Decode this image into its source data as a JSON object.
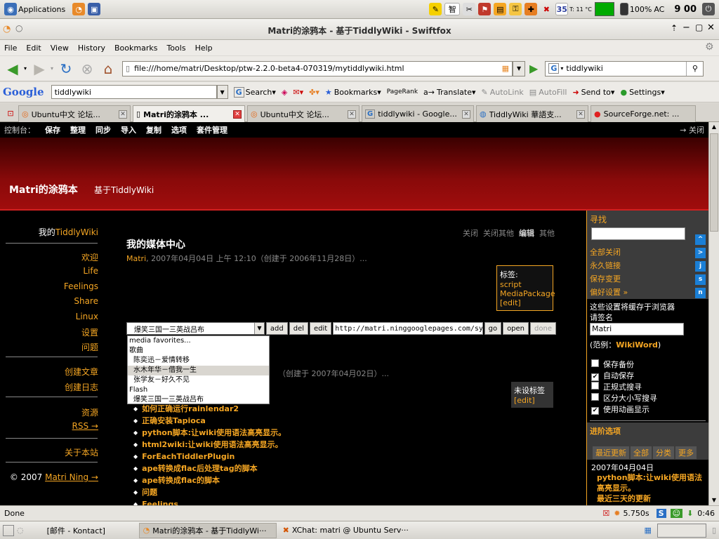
{
  "top_panel": {
    "applications": "Applications",
    "ime_label": "智",
    "temp": "35",
    "temp_sub": "T: 11 °C",
    "battery": "100%",
    "ac": "AC",
    "clock": "9 00"
  },
  "window": {
    "title": "Matri的涂鸦本 - 基于TiddlyWiki - Swiftfox"
  },
  "menubar": [
    "File",
    "Edit",
    "View",
    "History",
    "Bookmarks",
    "Tools",
    "Help"
  ],
  "navbar": {
    "url": "file:///home/matri/Desktop/ptw-2.2.0-beta4-070319/mytiddlywiki.html",
    "search_value": "tiddlywiki"
  },
  "google_bar": {
    "logo": "Google",
    "query": "tiddlywiki",
    "search": "Search",
    "bookmarks": "Bookmarks",
    "pagerank": "PageRank",
    "translate": "Translate",
    "autolink": "AutoLink",
    "autofill": "AutoFill",
    "send_to": "Send to",
    "settings": "Settings"
  },
  "tabs": [
    {
      "label": "Ubuntu中文 论坛...",
      "active": false
    },
    {
      "label": "Matri的涂鸦本 ...",
      "active": true
    },
    {
      "label": "Ubuntu中文 论坛...",
      "active": false
    },
    {
      "label": "tiddlywiki - Google...",
      "active": false
    },
    {
      "label": "TiddlyWiki 華語支...",
      "active": false
    },
    {
      "label": "SourceForge.net: ...",
      "active": false
    }
  ],
  "backstage": {
    "label": "控制台：",
    "items": [
      "保存",
      "整理",
      "同步",
      "导入",
      "复制",
      "选项",
      "套件管理"
    ],
    "close": "→ 关闭"
  },
  "site": {
    "title": "Matri的涂鸦本",
    "subtitle": "基于TiddlyWiki"
  },
  "main_menu": {
    "my_prefix": "我的",
    "my_link": "TiddlyWiki",
    "group1": [
      "欢迎",
      "Life",
      "Feelings",
      "Share",
      "Linux",
      "设置",
      "问题"
    ],
    "group2": [
      "创建文章",
      "创建日志"
    ],
    "group3": [
      "资源",
      "RSS →"
    ],
    "about": "关于本站",
    "copyright": "© 2007",
    "author": "Matri Ning →"
  },
  "tiddler": {
    "toolbar": [
      "关闭",
      "关闭其他",
      "编辑",
      "其他"
    ],
    "title": "我的媒体中心",
    "author": "Matri",
    "date": ", 2007年04月04日 上午 12:10（创建于 2006年11月28日）...",
    "tags_label": "标签:",
    "tags": [
      "script",
      "MediaPackage"
    ],
    "tags_edit": "[edit]"
  },
  "media_player": {
    "selected": "爆笑三国一三英战吕布",
    "buttons": [
      "add",
      "del",
      "edit"
    ],
    "url": "http://matri.ninggooglepages.com/sy2lb.swf",
    "go": "go",
    "open": "open",
    "done": "done",
    "options": [
      {
        "text": "media favorites...",
        "indent": false
      },
      {
        "text": "歌曲",
        "indent": false
      },
      {
        "text": "陈奕迅－爱情转移",
        "indent": true
      },
      {
        "text": "水木年华－借我一生",
        "indent": true,
        "selected": true
      },
      {
        "text": "张学友－好久不见",
        "indent": true
      },
      {
        "text": "Flash",
        "indent": false
      },
      {
        "text": "爆笑三国一三英战吕布",
        "indent": true
      }
    ]
  },
  "tiddler2": {
    "sub": "（创建于 2007年04月02日）...",
    "tags_label": "未设标签",
    "tags_edit": "[edit]",
    "list": [
      "如何正确运行rainlendar2",
      "正确安装Tapioca",
      "python脚本:让wiki使用语法高亮显示。",
      "html2wiki:让wiki使用语法高亮显示。",
      "ForEachTiddlerPlugin",
      "ape转换成flac后处理tag的脚本",
      "ape转换成flac的脚本",
      "问题",
      "Feelings"
    ]
  },
  "sidebar": {
    "search_label": "寻找",
    "links": [
      "全部关闭",
      "永久链接",
      "保存变更",
      "偏好设置 »"
    ],
    "pref_note": "这些设置将缓存于浏览器",
    "username_label": "请签名",
    "username": "Matri",
    "example_prefix": "(范例：",
    "example_word": "WikiWord",
    "example_suffix": ")",
    "options": [
      {
        "label": "保存备份",
        "checked": false
      },
      {
        "label": "自动保存",
        "checked": true
      },
      {
        "label": "正规式搜寻",
        "checked": false
      },
      {
        "label": "区分大小写搜寻",
        "checked": false
      },
      {
        "label": "使用动画显示",
        "checked": true
      }
    ],
    "advanced": "进阶选项",
    "tabs": [
      "最近更新",
      "全部",
      "分类",
      "更多"
    ],
    "recent_date": "2007年04月04日",
    "recent_items": [
      "python脚本:让wiki使用语法高亮显示。",
      "最近三天的更新"
    ],
    "side_icons": [
      "^",
      ">",
      "j",
      "s",
      "n"
    ]
  },
  "statusbar": {
    "text": "Done",
    "timing": "5.750s"
  },
  "bottom_panel": {
    "tasks": [
      {
        "label": "[邮件 - Kontact]",
        "active": false
      },
      {
        "label": "Matri的涂鸦本 - 基于TiddlyWi···",
        "active": true
      },
      {
        "label": "XChat: matri @ Ubuntu Serv···",
        "active": false
      }
    ],
    "clock": "0:46"
  }
}
